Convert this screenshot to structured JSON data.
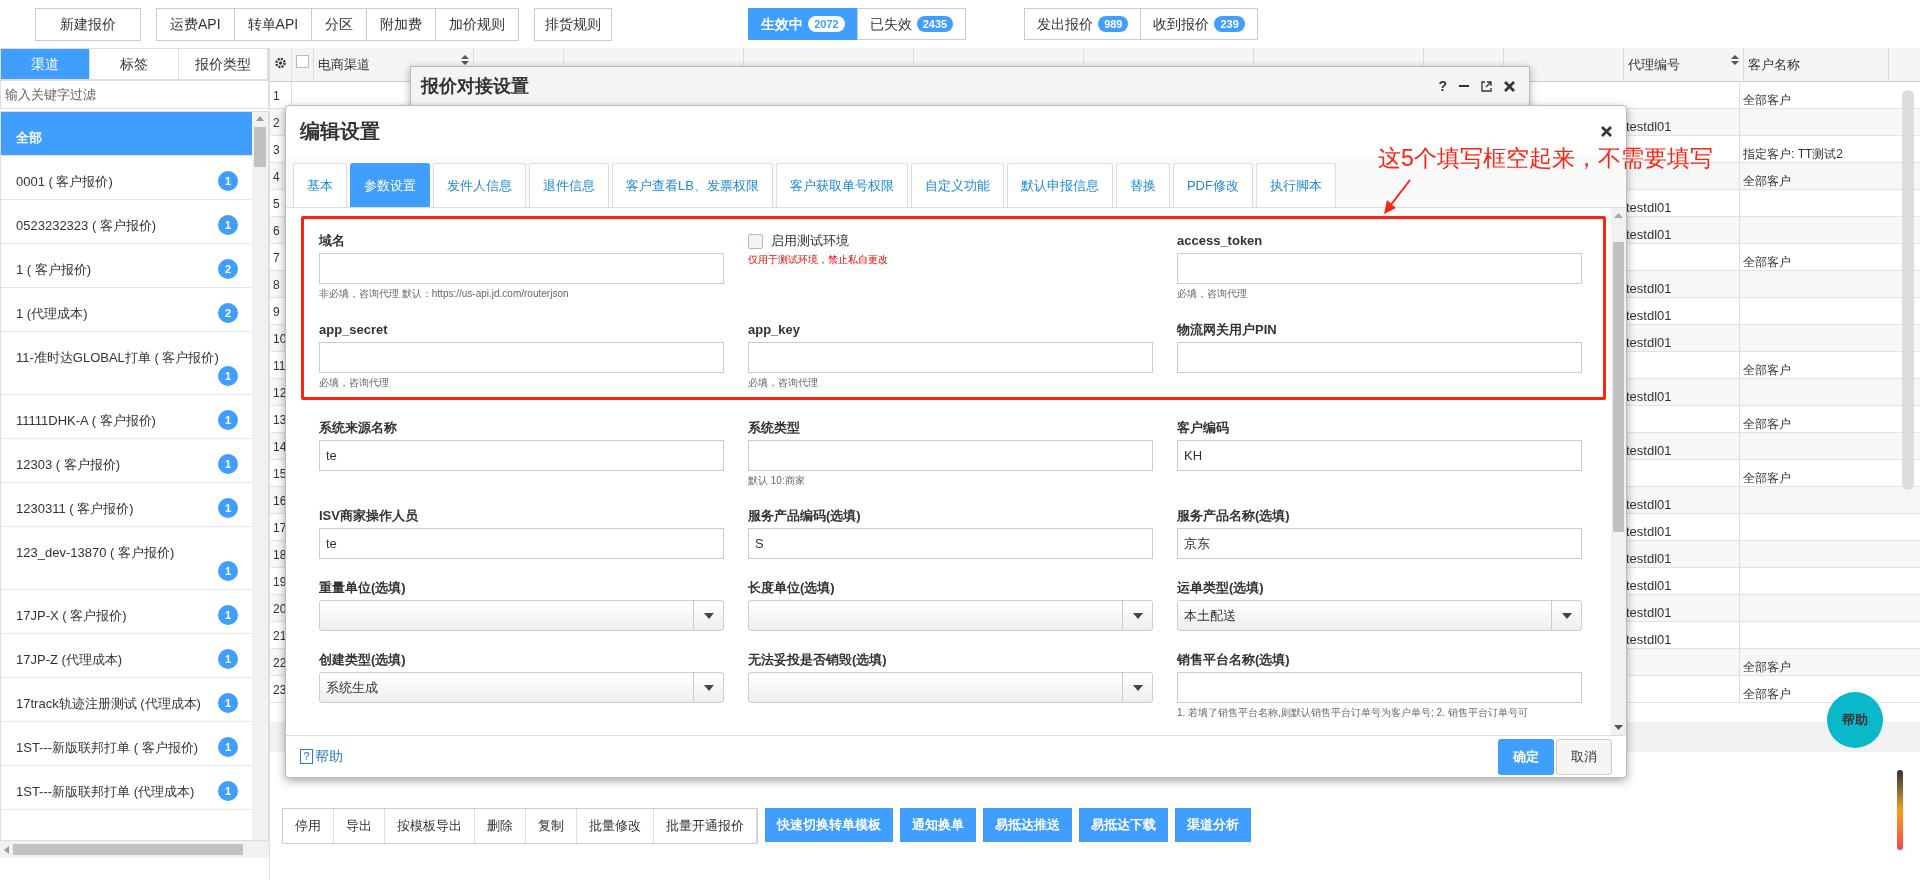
{
  "toolbar": {
    "new_button": "新建报价",
    "api_group": [
      "运费API",
      "转单API",
      "分区",
      "附加费",
      "加价规则"
    ],
    "rules_button": "排货规则",
    "status_tabs": [
      {
        "label": "生效中",
        "count": "2072",
        "selected": true
      },
      {
        "label": "已失效",
        "count": "2435",
        "selected": false
      }
    ],
    "direction_tabs": [
      {
        "label": "发出报价",
        "count": "989",
        "selected": false
      },
      {
        "label": "收到报价",
        "count": "239",
        "selected": false
      }
    ]
  },
  "sidebar": {
    "tabs": [
      {
        "label": "渠道",
        "selected": true
      },
      {
        "label": "标签",
        "selected": false
      },
      {
        "label": "报价类型",
        "selected": false
      }
    ],
    "filter_placeholder": "输入关键字过滤",
    "items": [
      {
        "label": "全部",
        "selected": true
      },
      {
        "label": "0001 ( 客户报价)",
        "count": "1",
        "selected": false
      },
      {
        "label": "0523232323 ( 客户报价)",
        "count": "1",
        "selected": false
      },
      {
        "label": "1 ( 客户报价)",
        "count": "2",
        "selected": false
      },
      {
        "label": "1 (代理成本)",
        "count": "2",
        "selected": false
      },
      {
        "label": "11-准时达GLOBAL打单 ( 客户报价)",
        "count": "1",
        "selected": false
      },
      {
        "label": "11111DHK-A ( 客户报价)",
        "count": "1",
        "selected": false
      },
      {
        "label": "12303 ( 客户报价)",
        "count": "1",
        "selected": false
      },
      {
        "label": "1230311 ( 客户报价)",
        "count": "1",
        "selected": false
      },
      {
        "label": "123_dev-13870 ( 客户报价)",
        "count": "1",
        "selected": false
      },
      {
        "label": "17JP-X ( 客户报价)",
        "count": "1",
        "selected": false
      },
      {
        "label": "17JP-Z (代理成本)",
        "count": "1",
        "selected": false
      },
      {
        "label": "17track轨迹注册测试 (代理成本)",
        "count": "1",
        "selected": false
      },
      {
        "label": "1ST---新版联邦打单 ( 客户报价)",
        "count": "1",
        "selected": false
      },
      {
        "label": "1ST---新版联邦打单 (代理成本)",
        "count": "1",
        "selected": false
      }
    ]
  },
  "table": {
    "select_all_checked": false,
    "columns": [
      "电商渠道",
      "代理编号",
      "客户名称"
    ],
    "rows": [
      {
        "number": "1",
        "agent_code": "",
        "customer": "全部客户"
      },
      {
        "number": "2",
        "agent_code": "testdl01",
        "customer": ""
      },
      {
        "number": "3",
        "agent_code": "",
        "customer": "指定客户: TT测试2"
      },
      {
        "number": "4",
        "agent_code": "",
        "customer": "全部客户"
      },
      {
        "number": "5",
        "agent_code": "testdl01",
        "customer": ""
      },
      {
        "number": "6",
        "agent_code": "testdl01",
        "customer": ""
      },
      {
        "number": "7",
        "agent_code": "",
        "customer": "全部客户"
      },
      {
        "number": "8",
        "agent_code": "testdl01",
        "customer": ""
      },
      {
        "number": "9",
        "agent_code": "testdl01",
        "customer": ""
      },
      {
        "number": "10",
        "agent_code": "testdl01",
        "customer": ""
      },
      {
        "number": "11",
        "agent_code": "",
        "customer": "全部客户"
      },
      {
        "number": "12",
        "agent_code": "testdl01",
        "customer": ""
      },
      {
        "number": "13",
        "agent_code": "",
        "customer": "全部客户"
      },
      {
        "number": "14",
        "agent_code": "testdl01",
        "customer": ""
      },
      {
        "number": "15",
        "agent_code": "",
        "customer": "全部客户"
      },
      {
        "number": "16",
        "agent_code": "testdl01",
        "customer": ""
      },
      {
        "number": "17",
        "agent_code": "testdl01",
        "customer": ""
      },
      {
        "number": "18",
        "agent_code": "testdl01",
        "customer": ""
      },
      {
        "number": "19",
        "agent_code": "testdl01",
        "customer": ""
      },
      {
        "number": "20",
        "agent_code": "testdl01",
        "customer": ""
      },
      {
        "number": "21",
        "agent_code": "testdl01",
        "customer": ""
      },
      {
        "number": "22",
        "agent_code": "",
        "customer": "全部客户"
      },
      {
        "number": "23",
        "agent_code": "",
        "customer": "全部客户"
      }
    ]
  },
  "bottom_toolbar": {
    "plain": [
      "停用",
      "导出",
      "按模板导出",
      "删除",
      "复制",
      "批量修改",
      "批量开通报价"
    ],
    "primary": [
      "快速切换转单模板",
      "通知换单",
      "易抵达推送",
      "易抵达下载",
      "渠道分析"
    ]
  },
  "help_bubble": "帮助",
  "back_dialog": {
    "title": "报价对接设置",
    "help_icon": "?"
  },
  "dialog": {
    "title": "编辑设置",
    "tabs": [
      {
        "label": "基本",
        "selected": false
      },
      {
        "label": "参数设置",
        "selected": true
      },
      {
        "label": "发件人信息",
        "selected": false
      },
      {
        "label": "退件信息",
        "selected": false
      },
      {
        "label": "客户查看LB、发票权限",
        "selected": false
      },
      {
        "label": "客户获取单号权限",
        "selected": false
      },
      {
        "label": "自定义功能",
        "selected": false
      },
      {
        "label": "默认申报信息",
        "selected": false
      },
      {
        "label": "替换",
        "selected": false
      },
      {
        "label": "PDF修改",
        "selected": false
      },
      {
        "label": "执行脚本",
        "selected": false
      }
    ],
    "annotated_fields": [
      {
        "kind": "text",
        "label": "域名",
        "hint": "非必填，咨询代理 默认：https://us-api.jd.com/routerjson"
      },
      {
        "kind": "checkbox",
        "label": "启用测试环境",
        "checked": false,
        "hint": "仅用于测试环境，禁止私自更改",
        "warning": true
      },
      {
        "kind": "text",
        "label": "access_token",
        "hint": "必填，咨询代理"
      },
      {
        "kind": "text",
        "label": "app_secret",
        "hint": "必填，咨询代理"
      },
      {
        "kind": "text",
        "label": "app_key",
        "hint": "必填，咨询代理"
      },
      {
        "kind": "text",
        "label": "物流网关用户PIN"
      }
    ],
    "fields": [
      {
        "kind": "text",
        "label": "系统来源名称",
        "value": "te"
      },
      {
        "kind": "text",
        "label": "系统类型",
        "hint": "默认 10:商家"
      },
      {
        "kind": "text",
        "label": "客户编码",
        "value": "KH"
      },
      {
        "kind": "text",
        "label": "ISV商家操作人员",
        "value": "te"
      },
      {
        "kind": "text",
        "label": "服务产品编码(选填)",
        "value": "S"
      },
      {
        "kind": "text",
        "label": "服务产品名称(选填)",
        "value": "京东"
      },
      {
        "kind": "select",
        "label": "重量单位(选填)"
      },
      {
        "kind": "select",
        "label": "长度单位(选填)"
      },
      {
        "kind": "select",
        "label": "运单类型(选填)",
        "value": "本土配送"
      },
      {
        "kind": "select",
        "label": "创建类型(选填)",
        "value": "系统生成"
      },
      {
        "kind": "select",
        "label": "无法妥投是否销毁(选填)"
      },
      {
        "kind": "text",
        "label": "销售平台名称(选填)",
        "hint": "1. 若填了销售平台名称,则默认销售平台订单号为客户单号; 2. 销售平台订单号可"
      }
    ],
    "help_link": "帮助",
    "help_icon": "?",
    "ok": "确定",
    "cancel": "取消"
  },
  "annotation": {
    "text": "这5个填写框空起来，不需要填写"
  }
}
